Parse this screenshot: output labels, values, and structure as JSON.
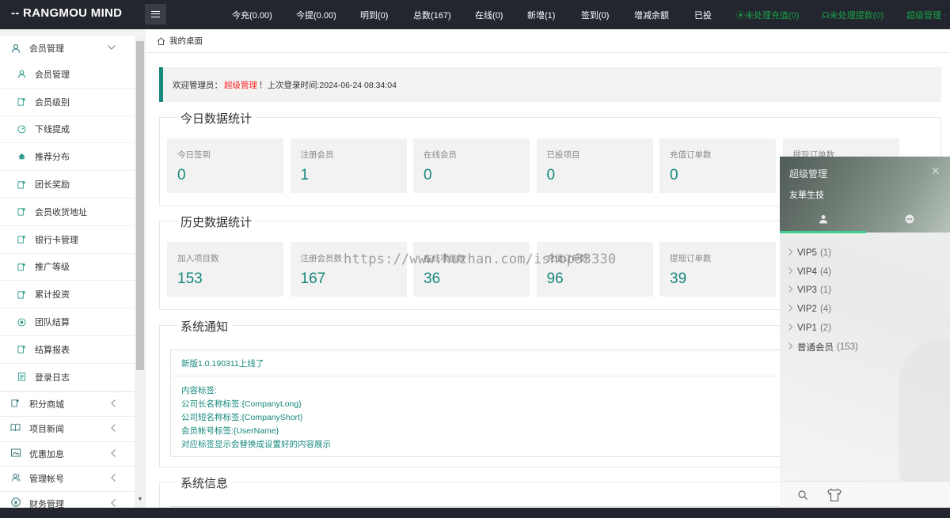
{
  "app": {
    "logo": "-- RANGMOU MIND"
  },
  "topnav": [
    {
      "label": "今充(0.00)",
      "color": "white"
    },
    {
      "label": "今提(0.00)",
      "color": "white"
    },
    {
      "label": "明到(0)",
      "color": "white"
    },
    {
      "label": "总数(167)",
      "color": "white"
    },
    {
      "label": "在线(0)",
      "color": "white"
    },
    {
      "label": "新增(1)",
      "color": "white"
    },
    {
      "label": "签到(0)",
      "color": "white"
    },
    {
      "label": "增减余额",
      "color": "white"
    },
    {
      "label": "已投",
      "color": "white"
    },
    {
      "label": "⦿未处理充值(0)",
      "color": "#19a14a"
    },
    {
      "label": "☊未处理提款(0)",
      "color": "#19a14a"
    },
    {
      "label": "超级管理 ·",
      "color": "#19a14a"
    }
  ],
  "sidebar": {
    "group_open": {
      "label": "会员管理",
      "icon": "user-icon"
    },
    "items": [
      {
        "label": "会员管理",
        "icon": "user-icon"
      },
      {
        "label": "会员级别",
        "icon": "grid-icon"
      },
      {
        "label": "下线提成",
        "icon": "gauge-icon"
      },
      {
        "label": "推荐分布",
        "icon": "tree-icon"
      },
      {
        "label": "团长奖励",
        "icon": "grid-icon"
      },
      {
        "label": "会员收货地址",
        "icon": "grid-icon"
      },
      {
        "label": "银行卡管理",
        "icon": "grid-icon"
      },
      {
        "label": "推广等级",
        "icon": "grid-icon"
      },
      {
        "label": "累计投资",
        "icon": "grid-icon"
      },
      {
        "label": "团队结算",
        "icon": "target-icon"
      },
      {
        "label": "结算报表",
        "icon": "grid-icon"
      },
      {
        "label": "登录日志",
        "icon": "list-icon"
      }
    ],
    "groups": [
      {
        "label": "积分商城",
        "icon": "grid-icon"
      },
      {
        "label": "项目新闻",
        "icon": "book-icon"
      },
      {
        "label": "优惠加息",
        "icon": "image-icon"
      },
      {
        "label": "管理帐号",
        "icon": "users-icon"
      },
      {
        "label": "财务管理",
        "icon": "money-icon"
      }
    ]
  },
  "breadcrumb": {
    "label": "我的桌面"
  },
  "welcome": {
    "prefix": "欢迎管理员：",
    "role": "超级管理",
    "suffix": "！上次登录时间:2024-06-24 08:34:04"
  },
  "today_stats": {
    "title": "今日数据统计",
    "cards": [
      {
        "label": "今日签到",
        "value": "0"
      },
      {
        "label": "注册会员",
        "value": "1"
      },
      {
        "label": "在线会员",
        "value": "0"
      },
      {
        "label": "已投项目",
        "value": "0"
      },
      {
        "label": "充值订单数",
        "value": "0"
      },
      {
        "label": "提现订单数",
        "value": ""
      }
    ]
  },
  "history_stats": {
    "title": "历史数据统计",
    "cards": [
      {
        "label": "加入项目数",
        "value": "153"
      },
      {
        "label": "注册会员数",
        "value": "167"
      },
      {
        "label": "在线项目数",
        "value": "36"
      },
      {
        "label": "充值订单数",
        "value": "96"
      },
      {
        "label": "提现订单数",
        "value": "39"
      }
    ]
  },
  "notice": {
    "title": "系统通知",
    "headline": "新版1.0.190311上线了",
    "lines": [
      "内容标签:",
      "公司长名称标签:{CompanyLong}",
      "公司短名称标签:{CompanyShort}",
      "会员帐号标签:{UserName}",
      "对应标签显示会替换成设置好的内容展示"
    ]
  },
  "sysinfo": {
    "title": "系统信息"
  },
  "watermark": "https://www.huzhan.com/ishop33330",
  "right_panel": {
    "title": "超级管理",
    "close": "✕",
    "company": "友華生技",
    "levels": [
      {
        "name": "VIP5",
        "count": "(1)"
      },
      {
        "name": "VIP4",
        "count": "(4)"
      },
      {
        "name": "VIP3",
        "count": "(1)"
      },
      {
        "name": "VIP2",
        "count": "(4)"
      },
      {
        "name": "VIP1",
        "count": "(2)"
      },
      {
        "name": "普通会员",
        "count": "(153)"
      }
    ],
    "accent": "#3ccf8e"
  },
  "colors": {
    "topbar": "#23262e",
    "accent": "#16887c",
    "role": "#ff2a2a",
    "alert": "#19a14a"
  }
}
